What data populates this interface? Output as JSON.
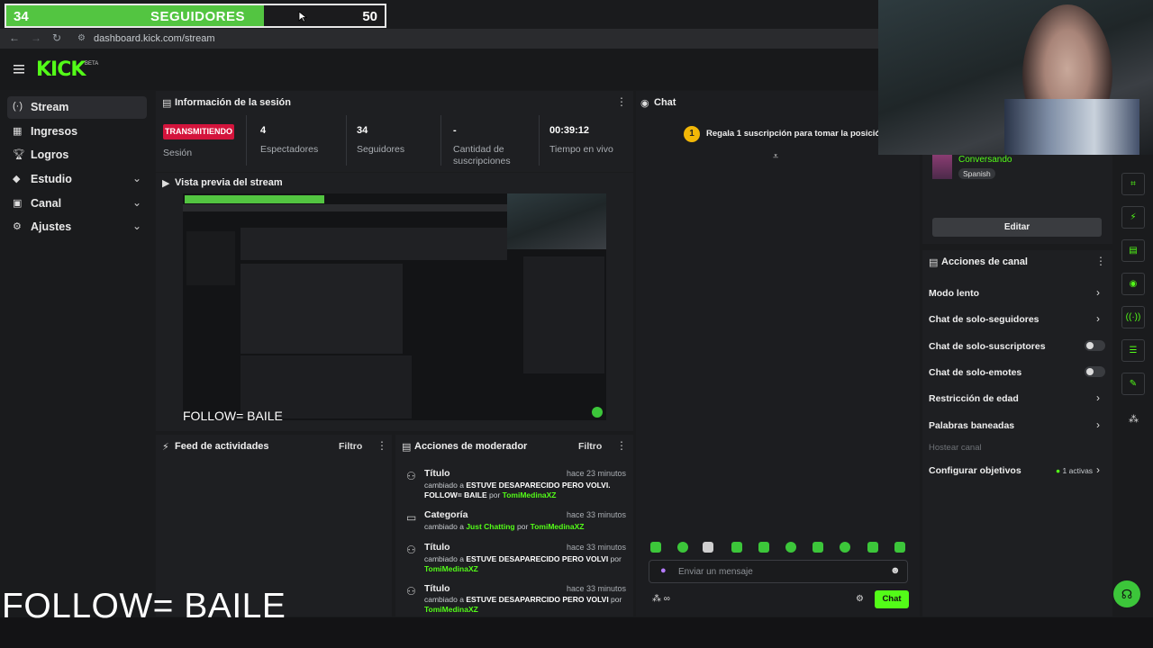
{
  "goal": {
    "current": "34",
    "label": "SEGUIDORES",
    "target": "50",
    "progress_fraction": 0.68
  },
  "browser": {
    "url": "dashboard.kick.com/stream"
  },
  "header": {
    "logo": "KICK",
    "beta": "BETA"
  },
  "sidebar": {
    "items": [
      {
        "icon": "stream-icon",
        "label": "Stream",
        "active": true
      },
      {
        "icon": "ingresos-icon",
        "label": "Ingresos"
      },
      {
        "icon": "trophy-icon",
        "label": "Logros"
      },
      {
        "icon": "studio-icon",
        "label": "Estudio",
        "expandable": true
      },
      {
        "icon": "channel-icon",
        "label": "Canal",
        "expandable": true
      },
      {
        "icon": "gear-icon",
        "label": "Ajustes",
        "expandable": true
      }
    ]
  },
  "session": {
    "title": "Información de la sesión",
    "status_badge": "TRANSMITIENDO",
    "status_label": "Sesión",
    "stats": [
      {
        "value": "4",
        "label": "Espectadores"
      },
      {
        "value": "34",
        "label": "Seguidores"
      },
      {
        "value": "-",
        "label": "Cantidad de suscripciones"
      },
      {
        "value": "00:39:12",
        "label": "Tiempo en vivo"
      }
    ]
  },
  "preview": {
    "title": "Vista previa del stream",
    "overlay_text": "FOLLOW= BAILE"
  },
  "feed": {
    "title": "Feed de actividades",
    "filter": "Filtro"
  },
  "mod_actions": {
    "title": "Acciones de moderador",
    "filter": "Filtro",
    "items": [
      {
        "title": "Título",
        "time": "hace 23 minutos",
        "prefix": "cambiado a ",
        "value": "ESTUVE DESAPARECIDO PERO VOLVI. FOLLOW= BAILE",
        "by": " por ",
        "user": "TomiMedinaXZ"
      },
      {
        "title": "Categoría",
        "time": "hace 33 minutos",
        "prefix": "cambiado a ",
        "value": "Just Chatting",
        "by": " por ",
        "user": "TomiMedinaXZ"
      },
      {
        "title": "Título",
        "time": "hace 33 minutos",
        "prefix": "cambiado a ",
        "value": "ESTUVE DESAPARECIDO PERO VOLVI",
        "by": " por ",
        "user": "TomiMedinaXZ"
      },
      {
        "title": "Título",
        "time": "hace 33 minutos",
        "prefix": "cambiado a ",
        "value": "ESTUVE DESAPARRCIDO PERO VOLVI",
        "by": " por ",
        "user": "TomiMedinaXZ"
      }
    ]
  },
  "chat": {
    "title": "Chat",
    "gift_rank": "1",
    "gift_text": "Regala 1 suscripción para tomar la posición 1",
    "input_placeholder": "Enviar un mensaje",
    "send_label": "Chat"
  },
  "stream_info": {
    "category": "Conversando",
    "language": "Spanish",
    "edit_label": "Editar"
  },
  "channel_actions": {
    "title": "Acciones de canal",
    "items": [
      {
        "label": "Modo lento",
        "control": "chevron"
      },
      {
        "label": "Chat de solo-seguidores",
        "control": "chevron"
      },
      {
        "label": "Chat de solo-suscriptores",
        "control": "toggle"
      },
      {
        "label": "Chat de solo-emotes",
        "control": "toggle"
      },
      {
        "label": "Restricción de edad",
        "control": "chevron"
      },
      {
        "label": "Palabras baneadas",
        "control": "chevron"
      },
      {
        "label": "Hostear canal",
        "control": "none",
        "disabled": true
      },
      {
        "label": "Configurar objetivos",
        "control": "chevron",
        "badge": "1 activas"
      }
    ]
  },
  "overlay_text": "FOLLOW= BAILE",
  "colors": {
    "accent": "#53fc18",
    "live": "#d4143c",
    "goal": "#53c541"
  }
}
